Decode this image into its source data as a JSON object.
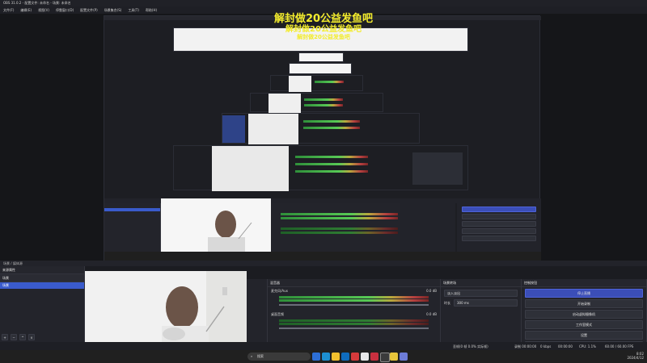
{
  "window": {
    "title": "OBS 31.0.2 - 配置文件: 未命名 - 场景: 未命名"
  },
  "menu": [
    "文件(F)",
    "编辑(E)",
    "视图(V)",
    "停靠窗口(D)",
    "配置文件(P)",
    "场景集合(S)",
    "工具(T)",
    "帮助(H)"
  ],
  "overlay": {
    "line1": "解封做20公益发鱼吧",
    "line2": "解封做20公益发鱼吧",
    "line3": "解封做20公益发鱼吧"
  },
  "scene_strip": {
    "text": "场景 / 媒体源"
  },
  "docks": {
    "scenes": {
      "title": "来源属性",
      "items": [
        "场景"
      ]
    },
    "sources": {
      "title": "来源",
      "items": [
        "场景"
      ]
    },
    "mixer": {
      "title": "混音器",
      "tracks": [
        {
          "name": "麦克风/Aux",
          "db": "0.0 dB"
        },
        {
          "name": "桌面音频",
          "db": "0.0 dB"
        }
      ]
    },
    "transitions": {
      "title": "场景转场",
      "type": "淡入淡出",
      "duration_label": "时长",
      "duration": "300 ms"
    },
    "controls": {
      "title": "控制按钮",
      "buttons": [
        "停止直播",
        "开始录制",
        "启动虚拟摄像机",
        "工作室模式",
        "设置",
        "退出"
      ]
    }
  },
  "status": {
    "left": "丢帧(0 帧 0.0% 实际帧)",
    "rec": "录制 00:00:00",
    "kbps": "0 kbps",
    "time": "00:00:00",
    "cpu": "CPU: 1.1%",
    "fps": "60.00 / 60.00 FPS"
  },
  "taskbar": {
    "search": "搜索",
    "clock": "8:02",
    "date": "2024/4/12"
  },
  "colors": {
    "accent": "#3b4eb8",
    "overlay_text": "#f3ec2d"
  }
}
